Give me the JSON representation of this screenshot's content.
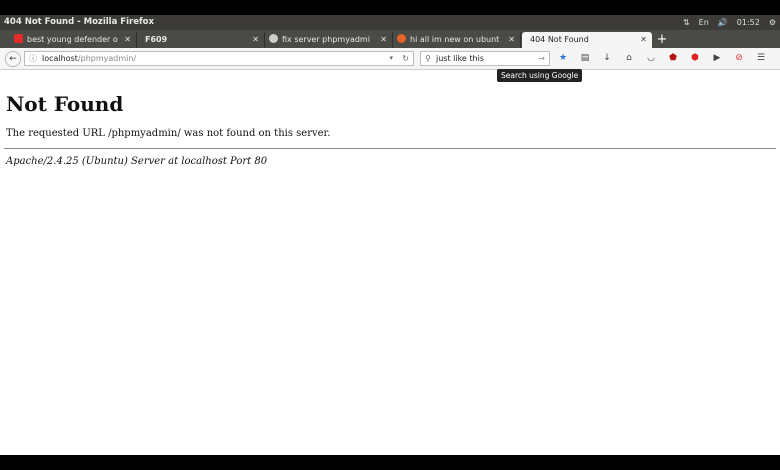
{
  "window": {
    "title": "404 Not Found - Mozilla Firefox",
    "tray_clock": "01:52",
    "tray_lang": "En"
  },
  "tabs": [
    {
      "label": "best young defender o",
      "favicon_color": "#e52d27",
      "active": false
    },
    {
      "label": "F609",
      "favicon_color": "",
      "active": false
    },
    {
      "label": "fix server phpmyadmi",
      "favicon_color": "#cccccc",
      "active": false
    },
    {
      "label": "hi all im new on ubunt",
      "favicon_color": "#e8622a",
      "active": false
    },
    {
      "label": "404 Not Found",
      "favicon_color": "",
      "active": true
    }
  ],
  "navbar": {
    "url_host": "localhost",
    "url_path": "/phpmyadmin/",
    "search_query": "just like this",
    "tooltip": "Search using Google"
  },
  "page": {
    "heading": "Not Found",
    "message": "The requested URL /phpmyadmin/ was not found on this server.",
    "server_signature": "Apache/2.4.25 (Ubuntu) Server at localhost Port 80"
  },
  "colors": {
    "titlebar": "#3c3b37",
    "tabbar": "#4a4a46",
    "accent_bookmark": "#2a72d9"
  }
}
